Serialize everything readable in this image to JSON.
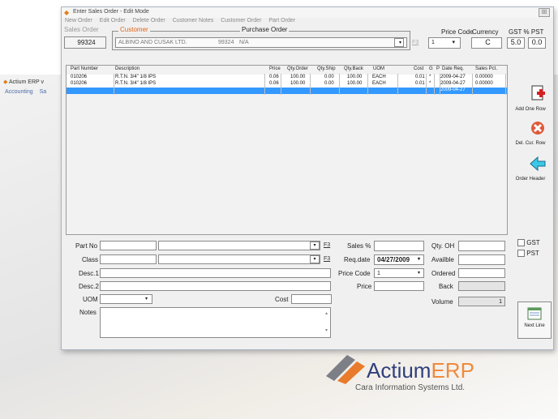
{
  "background_app": {
    "title": "Actium ERP v",
    "menu": [
      "Accounting",
      "Sa"
    ],
    "logo_name": "Actium",
    "logo_name_accent": "ERP",
    "logo_tagline": "Cara Information Systems Ltd."
  },
  "window": {
    "title": "Enter Sales Order - Edit Mode",
    "menu": [
      "New Order",
      "Edit Order",
      "Delete Order",
      "Customer Notes",
      "Customer Order",
      "Part Order"
    ],
    "close_label": "☒"
  },
  "header": {
    "sales_order_label": "Sales Order",
    "sales_order_value": "99324",
    "customer_label": "Customer",
    "customer_name": "ALBINO AND CUSAK LTD.",
    "customer_code": "99324",
    "customer_extra": "N/A",
    "purchase_order_label": "Purchase Order",
    "f3_label": "F3",
    "price_code_label": "Price Code",
    "price_code_value": "1",
    "currency_label": "Currency",
    "currency_value": "C",
    "gst_pst_label": "GST % PST",
    "gst_value": "5.0",
    "pst_value": "0.0"
  },
  "grid": {
    "columns": [
      "Part Number",
      "Description",
      "Price",
      "Qty.Order",
      "Qty.Ship",
      "Qty.Back",
      "UOM",
      "Cost",
      "G",
      "P",
      "Date Req.",
      "Sales Pct."
    ],
    "rows": [
      {
        "part": "010206",
        "desc": "R.T.N. 3/4\" 1/8 IPS",
        "price": "0.06",
        "qty_order": "100.00",
        "qty_ship": "0.00",
        "qty_back": "100.00",
        "uom": "EACH",
        "cost": "0.01",
        "g": "*",
        "p": "",
        "date": "2009-04-27",
        "pct": "0.00000"
      },
      {
        "part": "010206",
        "desc": "R.T.N. 3/4\" 1/8 IPS",
        "price": "0.06",
        "qty_order": "100.00",
        "qty_ship": "0.00",
        "qty_back": "100.00",
        "uom": "EACH",
        "cost": "0.01",
        "g": "*",
        "p": "",
        "date": "2009-04-27",
        "pct": "0.00000"
      },
      {
        "part": "",
        "desc": "",
        "price": "",
        "qty_order": "",
        "qty_ship": "",
        "qty_back": "",
        "uom": "",
        "cost": "",
        "g": "",
        "p": "",
        "date": "2009-04-27",
        "pct": ""
      }
    ]
  },
  "side_buttons": {
    "add_row": "Add One Row",
    "del_row": "Del. Cur. Row",
    "order_header": "Order Header",
    "next_line": "Next Line"
  },
  "form": {
    "part_no_label": "Part No",
    "class_label": "Class",
    "desc1_label": "Desc.1",
    "desc2_label": "Desc.2",
    "uom_label": "UOM",
    "notes_label": "Notes",
    "cost_label": "Cost",
    "f3_label": "F3",
    "sales_pct_label": "Sales %",
    "req_date_label": "Req.date",
    "req_date_value": "04/27/2009",
    "price_code_label": "Price Code",
    "price_code_value": "1",
    "price_label": "Price",
    "qty_oh_label": "Qty. OH",
    "available_label": "Availble",
    "ordered_label": "Ordered",
    "back_label": "Back",
    "volume_label": "Volume",
    "volume_value": "1",
    "gst_label": "GST",
    "pst_label": "PST"
  },
  "colors": {
    "accent_orange": "#e0621a",
    "selection_blue": "#3399ff",
    "logo_blue": "#2f3f7a"
  },
  "icons": [
    "add-row-icon",
    "delete-row-icon",
    "arrow-left-icon",
    "next-line-icon",
    "app-diamond-icon"
  ]
}
